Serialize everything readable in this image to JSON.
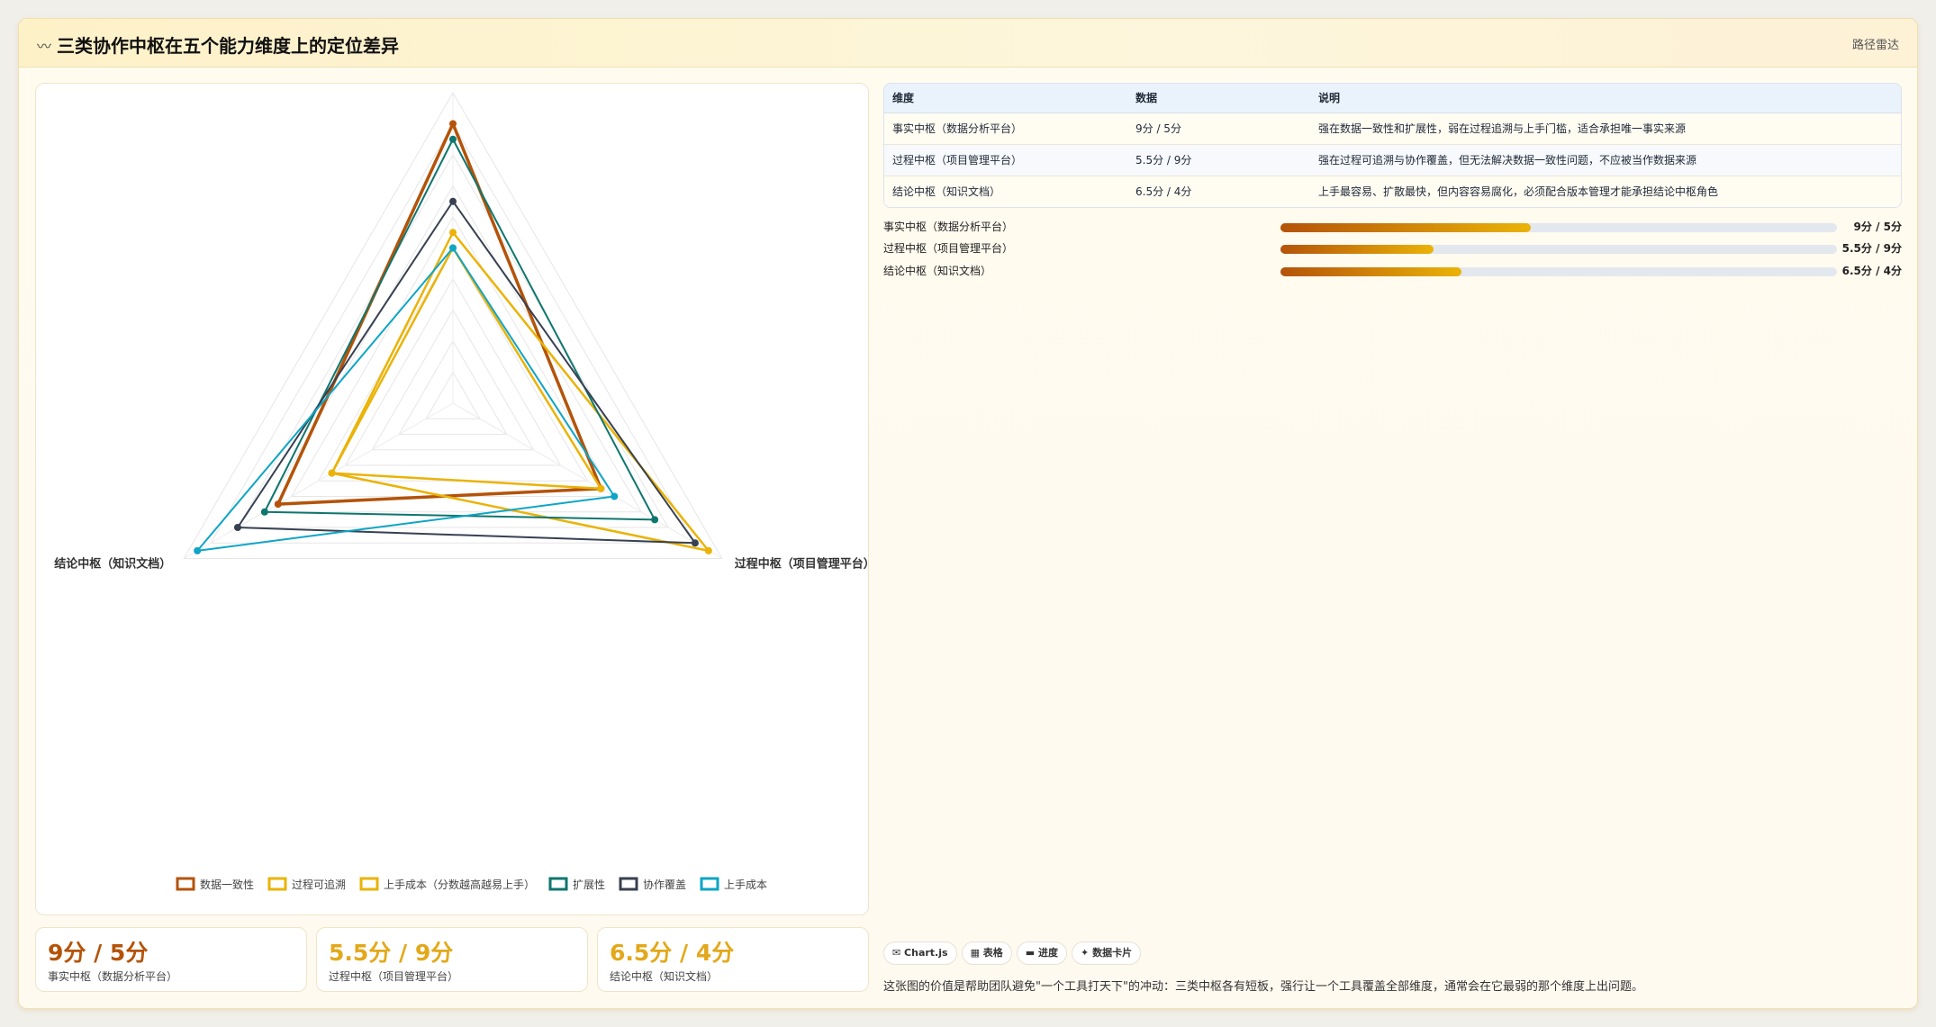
{
  "header": {
    "icon": "〰",
    "title": "三类协作中枢在五个能力维度上的定位差异",
    "subtitle": "路径雷达"
  },
  "chart_data": {
    "type": "radar",
    "axes": [
      "事实中枢（数据分析平台）",
      "过程中枢（项目管理平台）",
      "结论中枢（知识文档）"
    ],
    "scale": [
      0,
      10
    ],
    "series": [
      {
        "name": "数据一致性",
        "values": [
          9,
          5.5,
          6.5
        ],
        "color": "#b45309",
        "width": 3.5
      },
      {
        "name": "过程可追溯",
        "values": [
          5.5,
          9.5,
          4.5
        ],
        "color": "#eab308",
        "width": 2.5
      },
      {
        "name": "上手成本（分数越高越易上手）",
        "values": [
          5,
          5.5,
          4.5
        ],
        "color": "#eab308",
        "width": 2.5
      },
      {
        "name": "扩展性",
        "values": [
          8.5,
          7.5,
          7
        ],
        "color": "#0f766e",
        "width": 2
      },
      {
        "name": "协作覆盖",
        "values": [
          6.5,
          9,
          8
        ],
        "color": "#374151",
        "width": 2
      },
      {
        "name": "上手成本",
        "values": [
          5,
          6,
          9.5
        ],
        "color": "#0ea5c6",
        "width": 2
      }
    ]
  },
  "stats": [
    {
      "value": "9分 / 5分",
      "label": "事实中枢（数据分析平台）",
      "color": "#b45309"
    },
    {
      "value": "5.5分 / 9分",
      "label": "过程中枢（项目管理平台）",
      "color": "#e3a81a"
    },
    {
      "value": "6.5分 / 4分",
      "label": "结论中枢（知识文档）",
      "color": "#e3a81a"
    }
  ],
  "table": {
    "headers": [
      "维度",
      "数据",
      "说明"
    ],
    "rows": [
      [
        "事实中枢（数据分析平台）",
        "9分 / 5分",
        "强在数据一致性和扩展性，弱在过程追溯与上手门槛，适合承担唯一事实来源"
      ],
      [
        "过程中枢（项目管理平台）",
        "5.5分 / 9分",
        "强在过程可追溯与协作覆盖，但无法解决数据一致性问题，不应被当作数据来源"
      ],
      [
        "结论中枢（知识文档）",
        "6.5分 / 4分",
        "上手最容易、扩散最快，但内容容易腐化，必须配合版本管理才能承担结论中枢角色"
      ]
    ]
  },
  "progress": [
    {
      "label": "事实中枢（数据分析平台）",
      "value": "9分 / 5分",
      "fraction": 0.45
    },
    {
      "label": "过程中枢（项目管理平台）",
      "value": "5.5分 / 9分",
      "fraction": 0.275
    },
    {
      "label": "结论中枢（知识文档）",
      "value": "6.5分 / 4分",
      "fraction": 0.325
    }
  ],
  "tags": [
    "✉ Chart.js",
    "▦ 表格",
    "▬ 进度",
    "✦ 数据卡片"
  ],
  "footnote": "这张图的价值是帮助团队避免\"一个工具打天下\"的冲动：三类中枢各有短板，强行让一个工具覆盖全部维度，通常会在它最弱的那个维度上出问题。"
}
